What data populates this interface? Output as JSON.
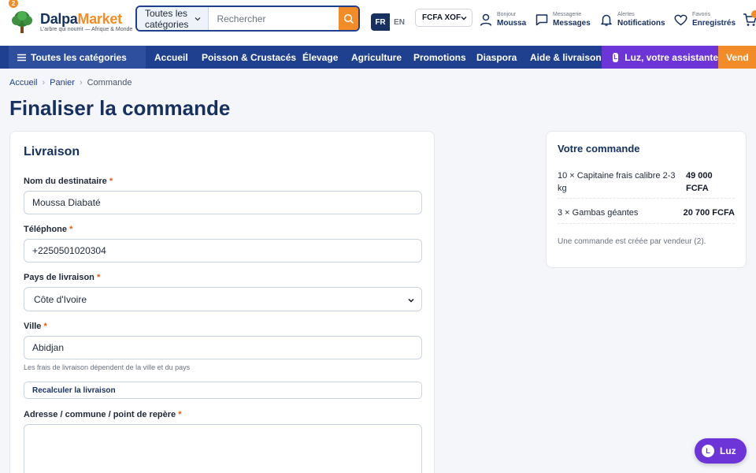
{
  "header": {
    "logo_badge": "2",
    "logo_part1": "Dalpa",
    "logo_part2": "Market",
    "tagline": "L'arbre qui nourrit — Afrique & Monde",
    "search_category": "Toutes les catégories",
    "search_placeholder": "Rechercher",
    "lang_fr": "FR",
    "lang_en": "EN",
    "currency": "FCFA XOF",
    "account_small": "Bonjour",
    "account_big": "Moussa",
    "messages_small": "Messagerie",
    "messages_big": "Messages",
    "alerts_small": "Alertes",
    "alerts_big": "Notifications",
    "favorites_small": "Favoris",
    "favorites_big": "Enregistrés"
  },
  "nav": {
    "all_categories": "Toutes les catégories",
    "items": [
      "Accueil",
      "Poisson & Crustacés",
      "Élevage",
      "Agriculture",
      "Promotions",
      "Diaspora",
      "Aide & livraison"
    ],
    "luz_dot": "L",
    "luz": "Luz, votre assistante",
    "vend": "Vend"
  },
  "breadcrumb": {
    "home": "Accueil",
    "cart": "Panier",
    "current": "Commande",
    "sep": "›"
  },
  "page_title": "Finaliser la commande",
  "delivery": {
    "title": "Livraison",
    "required_mark": "*",
    "recipient_label": "Nom du destinataire",
    "recipient_value": "Moussa Diabaté",
    "phone_label": "Téléphone",
    "phone_value": "+2250501020304",
    "country_label": "Pays de livraison",
    "country_value": "Côte d'Ivoire",
    "city_label": "Ville",
    "city_value": "Abidjan",
    "hint": "Les frais de livraison dépendent de la ville et du pays",
    "recalc_button": "Recalculer la livraison",
    "address_label": "Adresse / commune / point de repère"
  },
  "summary": {
    "title": "Votre commande",
    "items": [
      {
        "desc": "10 × Capitaine frais calibre 2-3 kg",
        "price": "49 000 FCFA"
      },
      {
        "desc": "3 × Gambas géantes",
        "price": "20 700 FCFA"
      }
    ],
    "note": "Une commande est créée par vendeur (2)."
  },
  "luz_fab": {
    "dot": "L",
    "label": "Luz"
  },
  "colors": {
    "navy": "#16305f",
    "nav_blue": "#1f3f8f",
    "orange": "#f28c28",
    "purple": "#6d35d8"
  }
}
